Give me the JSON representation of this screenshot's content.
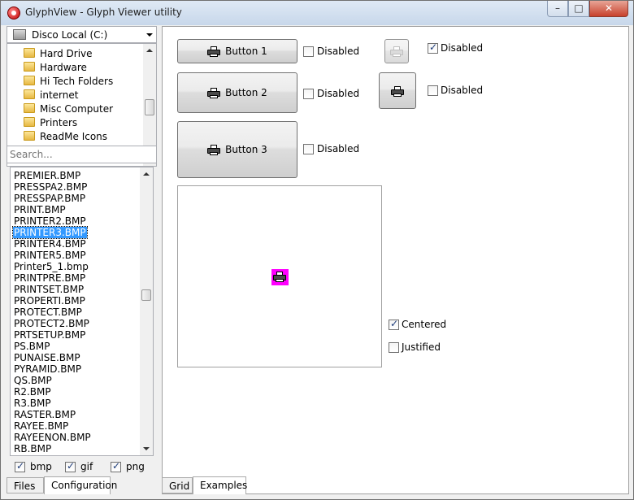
{
  "window": {
    "title": "GlyphView - Glyph Viewer utility",
    "controls": {
      "minimize": "–",
      "maximize": "□",
      "close": "✕"
    }
  },
  "left": {
    "drive": "Disco Local (C:)",
    "folders": [
      "Hard Drive",
      "Hardware",
      "Hi Tech Folders",
      "internet",
      "Misc Computer",
      "Printers",
      "ReadMe Icons"
    ],
    "search_placeholder": "Search...",
    "files": [
      "PREMIER.BMP",
      "PRESSPA2.BMP",
      "PRESSPAP.BMP",
      "PRINT.BMP",
      "PRINTER2.BMP",
      "PRINTER3.BMP",
      "PRINTER4.BMP",
      "PRINTER5.BMP",
      "Printer5_1.bmp",
      "PRINTPRE.BMP",
      "PRINTSET.BMP",
      "PROPERTI.BMP",
      "PROTECT.BMP",
      "PROTECT2.BMP",
      "PRTSETUP.BMP",
      "PS.BMP",
      "PUNAISE.BMP",
      "PYRAMID.BMP",
      "QS.BMP",
      "R2.BMP",
      "R3.BMP",
      "RASTER.BMP",
      "RAYEE.BMP",
      "RAYEENON.BMP",
      "RB.BMP"
    ],
    "selected_file": "PRINTER3.BMP",
    "filters": [
      {
        "label": "bmp",
        "checked": true
      },
      {
        "label": "gif",
        "checked": true
      },
      {
        "label": "png",
        "checked": true
      }
    ],
    "tabs": [
      "Files",
      "Configuration"
    ],
    "active_tab": "Configuration"
  },
  "right": {
    "buttons": [
      "Button 1",
      "Button 2",
      "Button 3"
    ],
    "disabled_label": "Disabled",
    "disabled_checks": [
      false,
      false,
      false,
      true,
      false
    ],
    "centered_label": "Centered",
    "centered_checked": true,
    "justified_label": "Justified",
    "justified_checked": false,
    "tabs": [
      "Grid",
      "Examples"
    ],
    "active_tab": "Examples",
    "glyph_background": "#ff00ff"
  },
  "icons": [
    "app-icon",
    "drive-icon",
    "folder-icon",
    "printer-icon",
    "combo-arrow-icon"
  ]
}
